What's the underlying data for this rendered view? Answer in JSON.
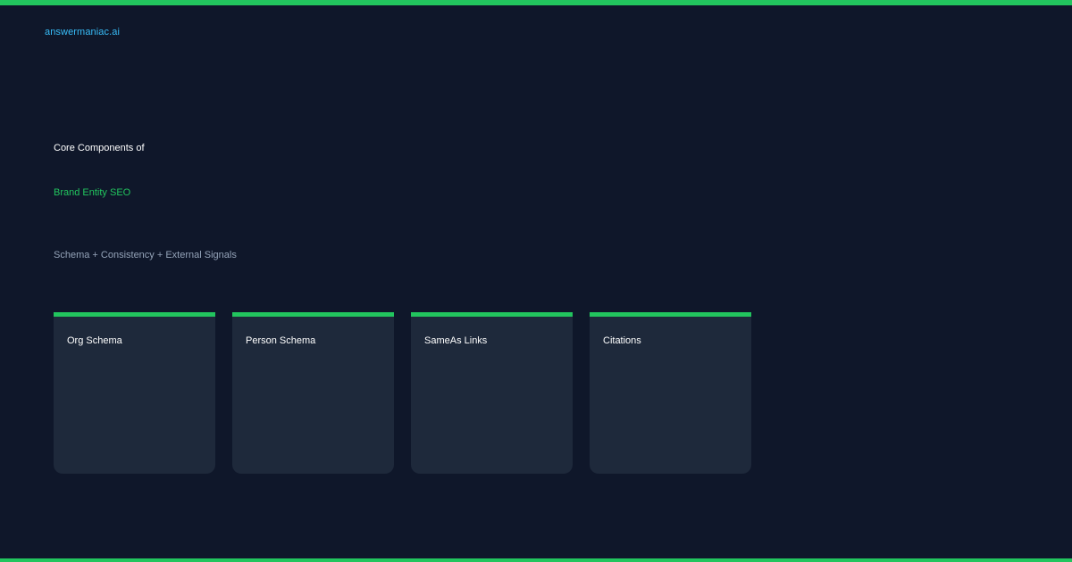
{
  "brand": {
    "name": "answermaniac.ai"
  },
  "hero": {
    "title_line1": "Core Components of",
    "title_line2": "Brand Entity SEO",
    "subtitle": "Schema + Consistency + External Signals"
  },
  "cards": [
    {
      "label": "Org Schema"
    },
    {
      "label": "Person Schema"
    },
    {
      "label": "SameAs Links"
    },
    {
      "label": "Citations"
    }
  ],
  "colors": {
    "background": "#0f172a",
    "card": "#1e293b",
    "accent": "#22c55e",
    "brand": "#38bdf8",
    "muted": "#94a3b8"
  }
}
